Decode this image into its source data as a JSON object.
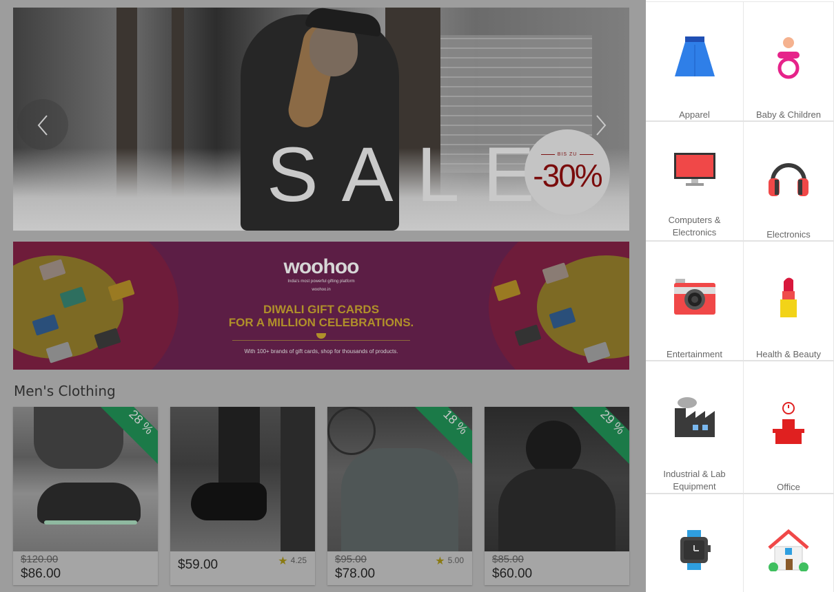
{
  "hero": {
    "sale_text": "SALE",
    "badge_top": "BIS ZU",
    "badge_value": "-30%"
  },
  "banner": {
    "logo": "woohoo",
    "tagline": "India's most powerful gifting platform",
    "site": "woohoo.in",
    "headline_1": "DIWALI GIFT CARDS",
    "headline_2": "FOR A MILLION CELEBRATIONS.",
    "footer": "With 100+ brands of gift cards, shop for thousands of products."
  },
  "section": {
    "title": "Men's Clothing"
  },
  "products": [
    {
      "discount": "28 %",
      "old_price": "$120.00",
      "price": "$86.00",
      "rating": ""
    },
    {
      "discount": "",
      "old_price": "",
      "price": "$59.00",
      "rating": "4.25"
    },
    {
      "discount": "18 %",
      "old_price": "$95.00",
      "price": "$78.00",
      "rating": "5.00"
    },
    {
      "discount": "29 %",
      "old_price": "$85.00",
      "price": "$60.00",
      "rating": ""
    }
  ],
  "categories": [
    {
      "label": "Apparel",
      "icon": "skirt-icon"
    },
    {
      "label": "Baby & Children",
      "icon": "pacifier-icon"
    },
    {
      "label": "Computers & Electronics",
      "icon": "monitor-icon"
    },
    {
      "label": "Electronics",
      "icon": "headphones-icon"
    },
    {
      "label": "Entertainment",
      "icon": "camera-icon"
    },
    {
      "label": "Health & Beauty",
      "icon": "lipstick-icon"
    },
    {
      "label": "Industrial & Lab Equipment",
      "icon": "factory-icon"
    },
    {
      "label": "Office",
      "icon": "office-desk-icon"
    },
    {
      "label": "",
      "icon": "watch-icon"
    },
    {
      "label": "",
      "icon": "house-icon"
    }
  ],
  "colors": {
    "ribbon": "#1b7a48",
    "badge_text": "#7a0c0c"
  }
}
